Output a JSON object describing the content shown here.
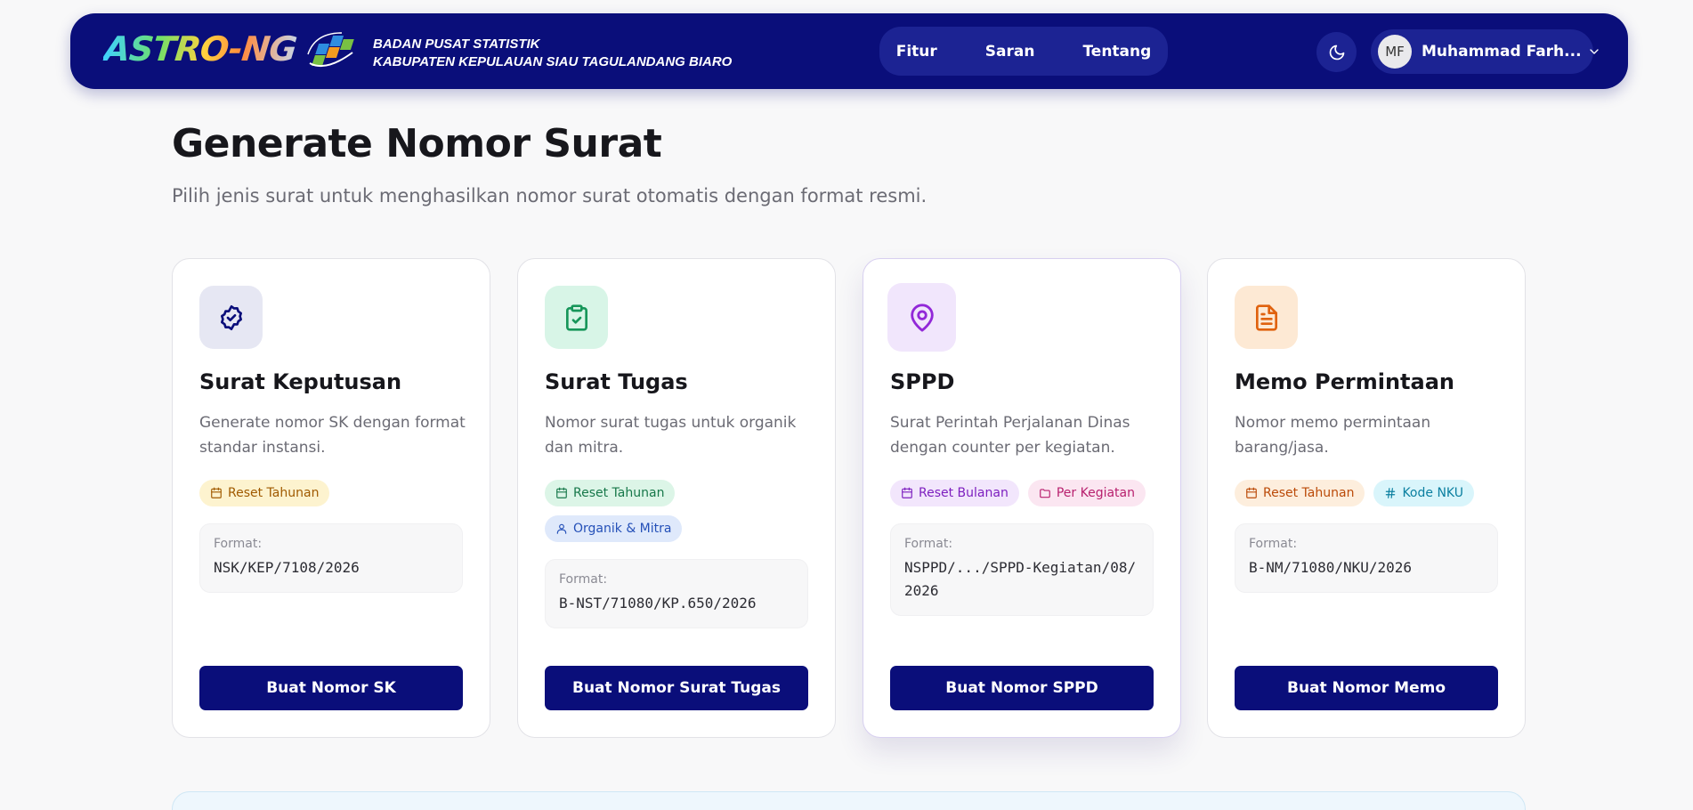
{
  "nav": {
    "logo_text": "ASTRO-NG",
    "org_line1": "BADAN PUSAT STATISTIK",
    "org_line2": "KABUPATEN KEPULAUAN SIAU TAGULANDANG BIARO",
    "links": [
      "Fitur",
      "Saran",
      "Tentang"
    ],
    "user_initials": "MF",
    "user_name": "Muhammad Farh..."
  },
  "page": {
    "title": "Generate Nomor Surat",
    "subtitle": "Pilih jenis surat untuk menghasilkan nomor surat otomatis dengan format resmi."
  },
  "cards": [
    {
      "title": "Surat Keputusan",
      "desc": "Generate nomor SK dengan format standar instansi.",
      "icon": "badge-check-icon",
      "icon_bg": "#e6e7f3",
      "icon_color": "#0a0e7a",
      "badges": [
        {
          "label": "Reset Tahunan",
          "icon": "calendar-icon",
          "bg": "#fdf3cf",
          "fg": "#a05a00"
        }
      ],
      "format_label": "Format:",
      "format_value": "NSK/KEP/7108/2026",
      "button": "Buat Nomor SK"
    },
    {
      "title": "Surat Tugas",
      "desc": "Nomor surat tugas untuk organik dan mitra.",
      "icon": "clipboard-check-icon",
      "icon_bg": "#d8f5e7",
      "icon_color": "#17965a",
      "badges": [
        {
          "label": "Reset Tahunan",
          "icon": "calendar-icon",
          "bg": "#dcf5e7",
          "fg": "#17784a"
        },
        {
          "label": "Organik & Mitra",
          "icon": "users-icon",
          "bg": "#dfe9fb",
          "fg": "#2450b8"
        }
      ],
      "format_label": "Format:",
      "format_value": "B-NST/71080/KP.650/2026",
      "button": "Buat Nomor Surat Tugas"
    },
    {
      "title": "SPPD",
      "desc": "Surat Perintah Perjalanan Dinas dengan counter per kegiatan.",
      "icon": "map-pin-icon",
      "icon_bg": "#f1e6fc",
      "icon_color": "#9228d8",
      "badges": [
        {
          "label": "Reset Bulanan",
          "icon": "calendar-icon",
          "bg": "#f2e6fc",
          "fg": "#7d1fbf"
        },
        {
          "label": "Per Kegiatan",
          "icon": "folder-icon",
          "bg": "#fbe6f1",
          "fg": "#b8206e"
        }
      ],
      "format_label": "Format:",
      "format_value": "NSPPD/.../SPPD-Kegiatan/08/2026",
      "button": "Buat Nomor SPPD"
    },
    {
      "title": "Memo Permintaan",
      "desc": "Nomor memo permintaan barang/jasa.",
      "icon": "file-text-icon",
      "icon_bg": "#fde9d4",
      "icon_color": "#e0620e",
      "badges": [
        {
          "label": "Reset Tahunan",
          "icon": "calendar-icon",
          "bg": "#fdeedd",
          "fg": "#bb4a08"
        },
        {
          "label": "Kode NKU",
          "icon": "hash-icon",
          "bg": "#d9f5fb",
          "fg": "#0a7fa0"
        }
      ],
      "format_label": "Format:",
      "format_value": "B-NM/71080/NKU/2026",
      "button": "Buat Nomor Memo"
    }
  ]
}
